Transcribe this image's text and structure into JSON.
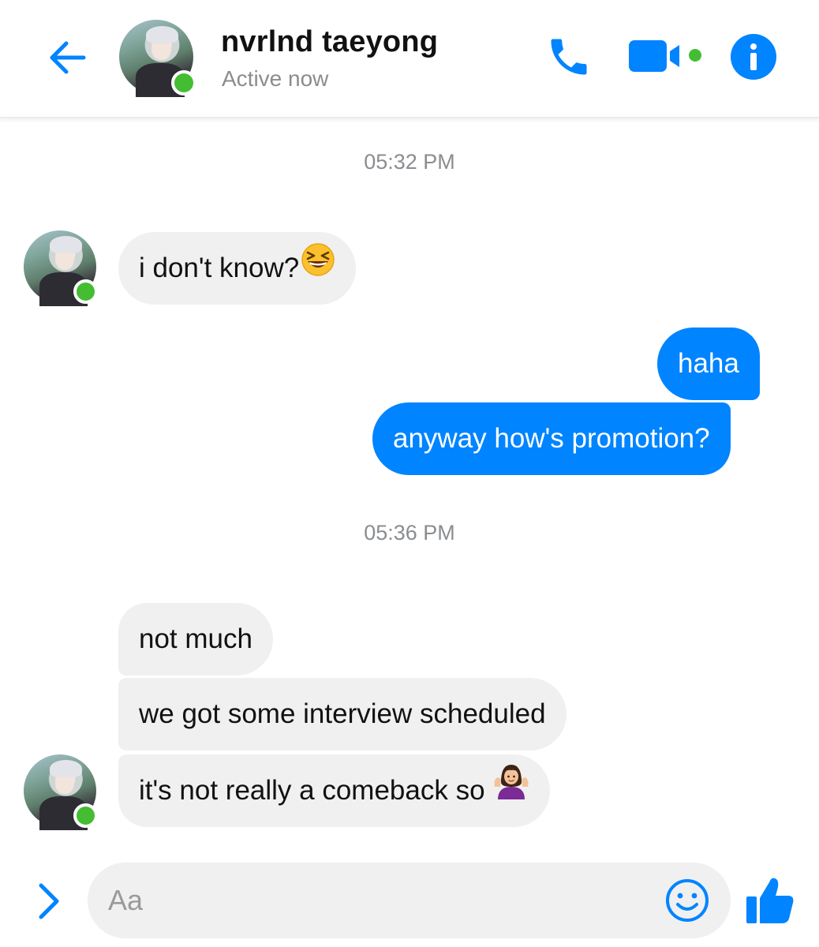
{
  "colors": {
    "accent": "#0084ff",
    "incoming_bubble": "#f0f0f0",
    "online": "#44bd32",
    "timestamp": "#8a8d91"
  },
  "header": {
    "back_icon": "arrow-left-icon",
    "contact_name": "nvrlnd taeyong",
    "status": "Active now",
    "actions": [
      "phone-icon",
      "video-camera-icon",
      "info-icon"
    ]
  },
  "conversation": {
    "timestamps": [
      "05:32 PM",
      "05:36 PM"
    ],
    "messages": [
      {
        "sender": "contact",
        "text": "i don't know?",
        "emoji": "grinning-squinting-face-emoji"
      },
      {
        "sender": "me",
        "text": "haha"
      },
      {
        "sender": "me",
        "text": "anyway how's promotion?"
      },
      {
        "sender": "contact",
        "text": "not much"
      },
      {
        "sender": "contact",
        "text": "we got some interview scheduled"
      },
      {
        "sender": "contact",
        "text": "it's not really a comeback so",
        "emoji": "person-shrugging-emoji"
      }
    ]
  },
  "composer": {
    "expand_icon": "chevron-right-icon",
    "placeholder": "Aa",
    "emoji_icon": "smiley-icon",
    "like_icon": "thumbs-up-icon"
  }
}
